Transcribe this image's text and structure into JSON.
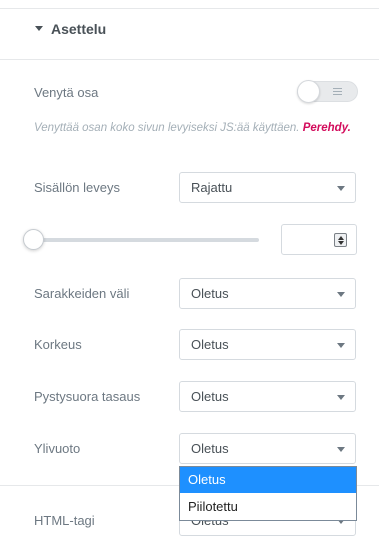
{
  "section": {
    "title": "Asettelu",
    "expanded": true
  },
  "stretch": {
    "label": "Venytä osa",
    "toggle_on": false,
    "help_text": "Venyttää osan koko sivun levyiseksi JS:ää käyttäen.",
    "help_link": "Perehdy."
  },
  "content_width": {
    "label": "Sisällön leveys",
    "value": "Rajattu"
  },
  "width_slider": {
    "value": "",
    "level": 0
  },
  "column_gap": {
    "label": "Sarakkeiden väli",
    "value": "Oletus"
  },
  "height": {
    "label": "Korkeus",
    "value": "Oletus"
  },
  "vertical_align": {
    "label": "Pystysuora tasaus",
    "value": "Oletus"
  },
  "overflow": {
    "label": "Ylivuoto",
    "value": "Oletus",
    "options": [
      "Oletus",
      "Piilotettu"
    ],
    "highlighted": "Oletus"
  },
  "html_tag": {
    "label": "HTML-tagi",
    "value": "Oletus"
  },
  "colors": {
    "link": "#d30c5c",
    "highlight": "#1e90ff"
  }
}
